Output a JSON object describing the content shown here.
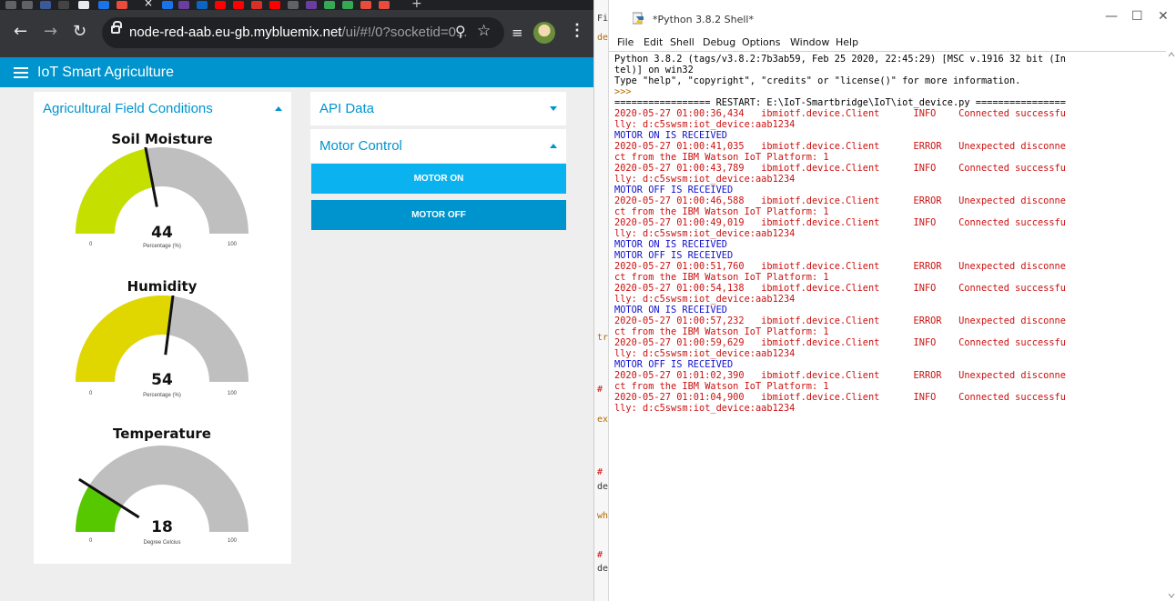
{
  "browser": {
    "url_host": "node-red-aab.eu-gb.mybluemix.net",
    "url_path": "/ui/#!/0?socketid=0..."
  },
  "dashboard": {
    "title": "IoT Smart Agriculture",
    "groups": {
      "field": "Agricultural Field Conditions",
      "api": "API Data",
      "motor": "Motor Control"
    },
    "gauges": [
      {
        "title": "Soil Moisture",
        "value": "44",
        "unit": "Percentage (%)",
        "min": "0",
        "max": "100",
        "fraction": 0.44,
        "color": "#c5e000"
      },
      {
        "title": "Humidity",
        "value": "54",
        "unit": "Percentage (%)",
        "min": "0",
        "max": "100",
        "fraction": 0.54,
        "color": "#e1d700"
      },
      {
        "title": "Temperature",
        "value": "18",
        "unit": "Degree Celcius",
        "min": "0",
        "max": "100",
        "fraction": 0.18,
        "color": "#55c800"
      }
    ],
    "buttons": {
      "motor_on": "MOTOR ON",
      "motor_off": "MOTOR OFF"
    }
  },
  "idle": {
    "window_title": "*Python 3.8.2 Shell*",
    "menu": [
      "File",
      "Edit",
      "Shell",
      "Debug",
      "Options",
      "Window",
      "Help"
    ],
    "behind_window_fragments": [
      "Fi",
      "de",
      "tr",
      "#",
      "ex",
      "#",
      "de",
      "wh",
      "#",
      "de"
    ],
    "lines": [
      {
        "t": "Python 3.8.2 (tags/v3.8.2:7b3ab59, Feb 25 2020, 22:45:29) [MSC v.1916 32 bit (In",
        "c": "black"
      },
      {
        "t": "tel)] on win32",
        "c": "black"
      },
      {
        "t": "Type \"help\", \"copyright\", \"credits\" or \"license()\" for more information.",
        "c": "black"
      },
      {
        "t": ">>> ",
        "c": "brown"
      },
      {
        "t": "================= RESTART: E:\\IoT-Smartbridge\\IoT\\iot_device.py ================",
        "c": "black"
      },
      {
        "t": "2020-05-27 01:00:36,434   ibmiotf.device.Client      INFO    Connected successfu",
        "c": "red"
      },
      {
        "t": "lly: d:c5swsm:iot_device:aab1234",
        "c": "red"
      },
      {
        "t": "MOTOR ON IS RECEIVED",
        "c": "blue"
      },
      {
        "t": "2020-05-27 01:00:41,035   ibmiotf.device.Client      ERROR   Unexpected disconne",
        "c": "red"
      },
      {
        "t": "ct from the IBM Watson IoT Platform: 1",
        "c": "red"
      },
      {
        "t": "2020-05-27 01:00:43,789   ibmiotf.device.Client      INFO    Connected successfu",
        "c": "red"
      },
      {
        "t": "lly: d:c5swsm:iot_device:aab1234",
        "c": "red"
      },
      {
        "t": "MOTOR OFF IS RECEIVED",
        "c": "blue"
      },
      {
        "t": "2020-05-27 01:00:46,588   ibmiotf.device.Client      ERROR   Unexpected disconne",
        "c": "red"
      },
      {
        "t": "ct from the IBM Watson IoT Platform: 1",
        "c": "red"
      },
      {
        "t": "2020-05-27 01:00:49,019   ibmiotf.device.Client      INFO    Connected successfu",
        "c": "red"
      },
      {
        "t": "lly: d:c5swsm:iot_device:aab1234",
        "c": "red"
      },
      {
        "t": "MOTOR ON IS RECEIVED",
        "c": "blue"
      },
      {
        "t": "MOTOR OFF IS RECEIVED",
        "c": "blue"
      },
      {
        "t": "2020-05-27 01:00:51,760   ibmiotf.device.Client      ERROR   Unexpected disconne",
        "c": "red"
      },
      {
        "t": "ct from the IBM Watson IoT Platform: 1",
        "c": "red"
      },
      {
        "t": "2020-05-27 01:00:54,138   ibmiotf.device.Client      INFO    Connected successfu",
        "c": "red"
      },
      {
        "t": "lly: d:c5swsm:iot_device:aab1234",
        "c": "red"
      },
      {
        "t": "MOTOR ON IS RECEIVED",
        "c": "blue"
      },
      {
        "t": "2020-05-27 01:00:57,232   ibmiotf.device.Client      ERROR   Unexpected disconne",
        "c": "red"
      },
      {
        "t": "ct from the IBM Watson IoT Platform: 1",
        "c": "red"
      },
      {
        "t": "2020-05-27 01:00:59,629   ibmiotf.device.Client      INFO    Connected successfu",
        "c": "red"
      },
      {
        "t": "lly: d:c5swsm:iot_device:aab1234",
        "c": "red"
      },
      {
        "t": "MOTOR OFF IS RECEIVED",
        "c": "blue"
      },
      {
        "t": "2020-05-27 01:01:02,390   ibmiotf.device.Client      ERROR   Unexpected disconne",
        "c": "red"
      },
      {
        "t": "ct from the IBM Watson IoT Platform: 1",
        "c": "red"
      },
      {
        "t": "2020-05-27 01:01:04,900   ibmiotf.device.Client      INFO    Connected successfu",
        "c": "red"
      },
      {
        "t": "lly: d:c5swsm:iot_device:aab1234",
        "c": "red"
      }
    ]
  },
  "colors": {
    "node_red_blue": "#0094ce",
    "button_on": "#0ab3ef",
    "button_off": "#0094ce",
    "gauge_track": "#bfbfbf",
    "shell_red": "#cc1111",
    "shell_blue": "#1111cc"
  }
}
